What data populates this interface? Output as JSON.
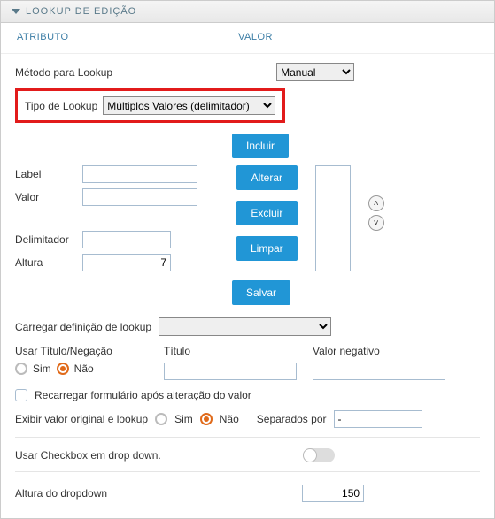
{
  "panel": {
    "title": "LOOKUP DE EDIÇÃO"
  },
  "headers": {
    "attr": "ATRIBUTO",
    "val": "VALOR"
  },
  "method": {
    "label": "Método para Lookup",
    "value": "Manual"
  },
  "lookupType": {
    "label": "Tipo de Lookup",
    "value": "Múltiplos Valores (delimitador)"
  },
  "buttons": {
    "incluir": "Incluir",
    "alterar": "Alterar",
    "excluir": "Excluir",
    "limpar": "Limpar",
    "salvar": "Salvar"
  },
  "fields": {
    "label": "Label",
    "labelVal": "",
    "valor": "Valor",
    "valorVal": "",
    "delim": "Delimitador",
    "delimVal": "",
    "altura": "Altura",
    "alturaVal": "7"
  },
  "loadDef": {
    "label": "Carregar definição de lookup",
    "value": ""
  },
  "titleNeg": {
    "useLabel": "Usar Título/Negação",
    "titleLabel": "Título",
    "titleVal": "",
    "negLabel": "Valor negativo",
    "negVal": "",
    "sim": "Sim",
    "nao": "Não"
  },
  "reload": {
    "label": "Recarregar formulário após alteração do valor"
  },
  "showOriginal": {
    "label": "Exibir valor original e lookup",
    "sim": "Sim",
    "nao": "Não",
    "sepLabel": "Separados por",
    "sepVal": "-"
  },
  "useCheckbox": {
    "label": "Usar Checkbox em drop down."
  },
  "ddHeight": {
    "label": "Altura do dropdown",
    "value": "150"
  }
}
